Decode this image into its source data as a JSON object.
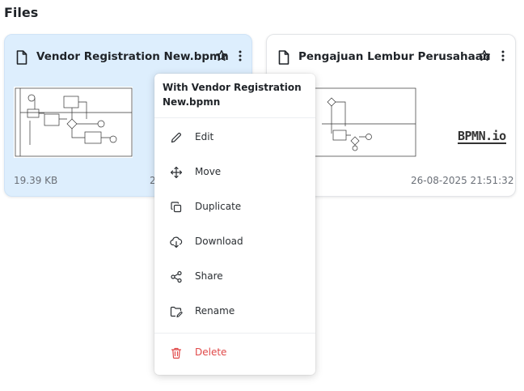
{
  "page": {
    "title": "Files"
  },
  "files": [
    {
      "name": "Vendor Registration New.bpmn",
      "size": "19.39 KB",
      "date": "2",
      "selected": true
    },
    {
      "name": "Pengajuan Lembur Perusahaan",
      "size": "",
      "date": "26-08-2025 21:51:32",
      "selected": false,
      "logo": "BPMN.io"
    }
  ],
  "context_menu": {
    "header": "With Vendor Registration New.bpmn",
    "items": [
      {
        "label": "Edit",
        "icon": "pencil-icon"
      },
      {
        "label": "Move",
        "icon": "move-icon"
      },
      {
        "label": "Duplicate",
        "icon": "duplicate-icon"
      },
      {
        "label": "Download",
        "icon": "cloud-download-icon"
      },
      {
        "label": "Share",
        "icon": "share-icon"
      },
      {
        "label": "Rename",
        "icon": "rename-icon"
      },
      {
        "label": "Delete",
        "icon": "trash-icon"
      }
    ]
  },
  "colors": {
    "selected_bg": "#ddeefd",
    "danger": "#e04848",
    "text": "#1f2328",
    "muted": "#6b7078"
  }
}
